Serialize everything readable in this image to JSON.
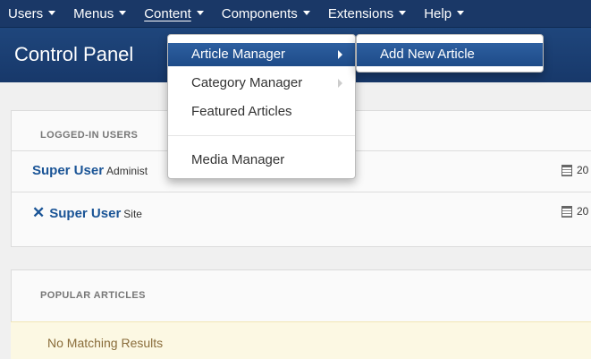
{
  "topnav": {
    "items": [
      "Users",
      "Menus",
      "Content",
      "Components",
      "Extensions",
      "Help"
    ]
  },
  "header": {
    "title": "Control Panel"
  },
  "logged_in": {
    "title": "LOGGED-IN USERS",
    "rows": [
      {
        "user": "Super User",
        "suffix": "Administ",
        "date": "20"
      },
      {
        "user": "Super User",
        "suffix": "Site",
        "date": "20"
      }
    ]
  },
  "popular": {
    "title": "POPULAR ARTICLES",
    "empty": "No Matching Results"
  },
  "content_menu": {
    "items": [
      "Article Manager",
      "Category Manager",
      "Featured Articles",
      "Media Manager"
    ]
  },
  "submenu": {
    "item": "Add New Article"
  },
  "colors": {
    "nav_bg": "#1a3867",
    "header_bg": "#1d4176",
    "highlight": "#2d5fa0",
    "link": "#1a5496"
  }
}
